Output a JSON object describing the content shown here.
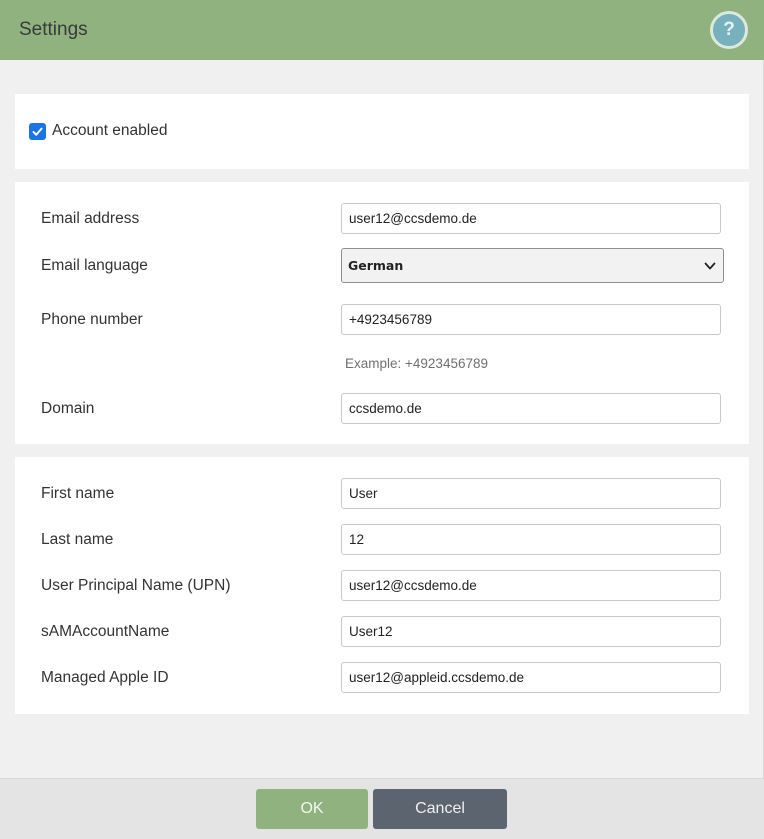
{
  "header": {
    "title": "Settings",
    "help_label": "?"
  },
  "account": {
    "enabled_label": "Account enabled",
    "enabled": true
  },
  "contact": {
    "email_label": "Email address",
    "email_value": "user12@ccsdemo.de",
    "language_label": "Email language",
    "language_value": "German",
    "phone_label": "Phone number",
    "phone_value": "+4923456789",
    "phone_hint": "Example: +4923456789",
    "domain_label": "Domain",
    "domain_value": "ccsdemo.de"
  },
  "identity": {
    "first_name_label": "First name",
    "first_name_value": "User",
    "last_name_label": "Last name",
    "last_name_value": "12",
    "upn_label": "User Principal Name (UPN)",
    "upn_value": "user12@ccsdemo.de",
    "sam_label": "sAMAccountName",
    "sam_value": "User12",
    "apple_id_label": "Managed Apple ID",
    "apple_id_value": "user12@appleid.ccsdemo.de"
  },
  "footer": {
    "ok_label": "OK",
    "cancel_label": "Cancel"
  },
  "colors": {
    "header": "#8fb27f",
    "help_button": "#76b1bd",
    "checkbox": "#1a73e8",
    "ok_button": "#8fb27f",
    "cancel_button": "#5c6470"
  }
}
